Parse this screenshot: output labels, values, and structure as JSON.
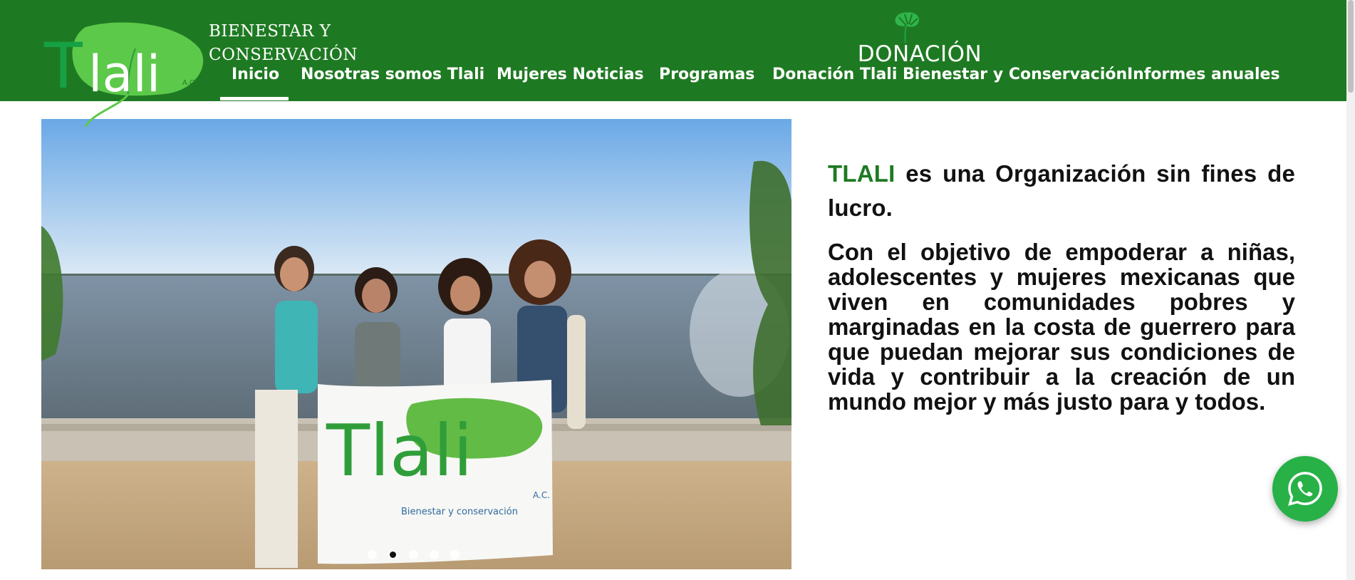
{
  "header": {
    "logo_text": "Tlali",
    "logo_suffix": "A.C.",
    "logo_tagline": "Bienestar y conservación",
    "brand_line1": "BIENESTAR Y",
    "brand_line2": "CONSERVACIÓN",
    "donation_label": "DONACIÓN",
    "bg_color": "#1e7a22"
  },
  "nav": {
    "items": [
      {
        "label": "Inicio",
        "active": true
      },
      {
        "label": "Nosotras somos Tlali"
      },
      {
        "label": "Mujeres Noticias"
      },
      {
        "label": "Programas"
      },
      {
        "label": "Donación Tlali Bienestar y Conservación"
      },
      {
        "label": "Informes anuales"
      }
    ]
  },
  "slider": {
    "banner_text": "Tlali",
    "banner_suffix": "A.C.",
    "banner_tagline": "Bienestar y conservación",
    "dot_count": 5,
    "active_dot": 2
  },
  "content": {
    "brand": "TLALI",
    "intro_rest": " es una Organización sin fines de lucro.",
    "mission": "Con el objetivo de empoderar a niñas, adolescentes y mujeres mexicanas que viven en comunidades pobres y marginadas en la costa de guerrero para que puedan mejorar sus condiciones de vida y contribuir a la creación de un mundo mejor y más justo para y todos."
  },
  "icons": {
    "whatsapp": "whatsapp-icon",
    "leaf": "monstera-leaf-icon"
  },
  "colors": {
    "brand_green": "#1e7a22",
    "whatsapp_green": "#27b147"
  }
}
